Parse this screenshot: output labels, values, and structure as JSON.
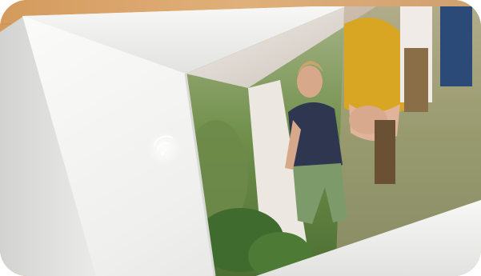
{
  "image": {
    "subject": "wifi-connected-digital-photo-frame",
    "icons": [
      "wifi-icon"
    ],
    "colors": {
      "table_wood": "#d9a76f",
      "frame_white": "#f4f4f2",
      "frame_shadow": "#d8d8d6",
      "wifi_glow": "#ffffff",
      "photo_green": "#6f8f4a",
      "shirt_navy": "#2f3650",
      "shirt_yellow": "#d9a623"
    }
  }
}
